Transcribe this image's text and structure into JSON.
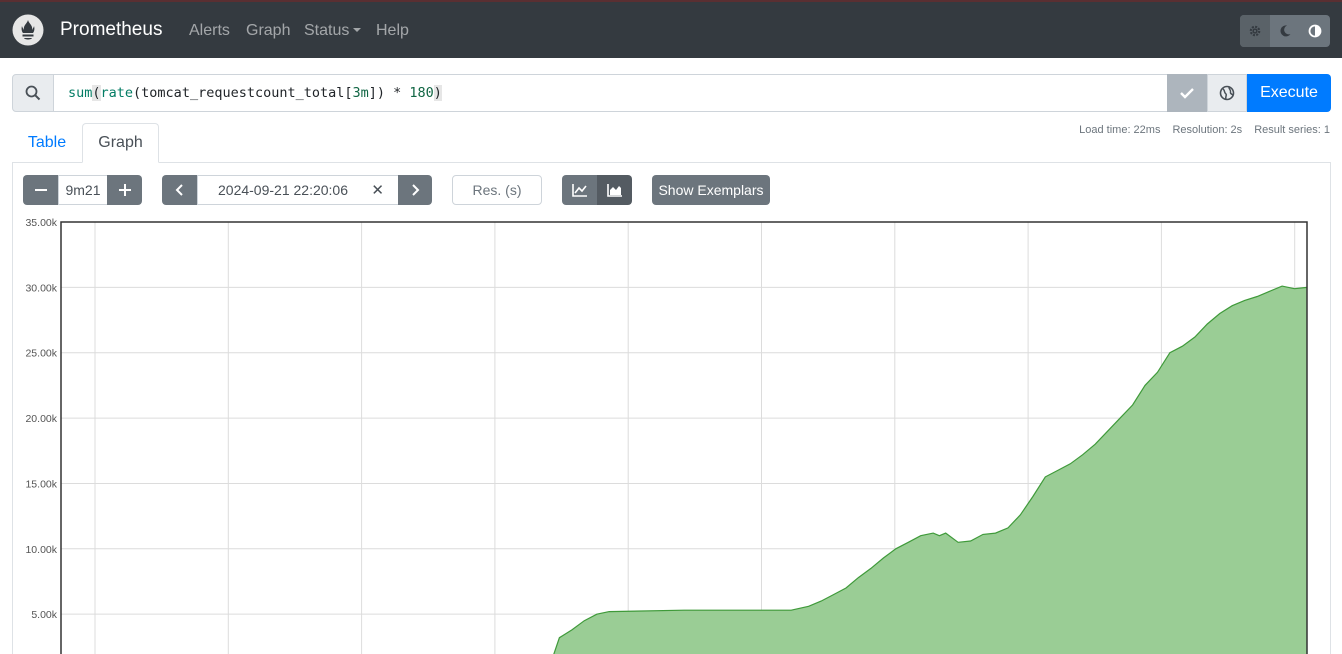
{
  "navbar": {
    "brand": "Prometheus",
    "links": [
      "Alerts",
      "Graph",
      "Status",
      "Help"
    ],
    "theme_buttons": [
      "gear-icon",
      "moon-icon",
      "contrast-icon"
    ]
  },
  "query": {
    "expression": "sum(rate(tomcat_requestcount_total[3m]) * 180)",
    "execute_label": "Execute"
  },
  "tabs": [
    "Table",
    "Graph"
  ],
  "stats": {
    "load_time": "Load time: 22ms",
    "resolution": "Resolution: 2s",
    "result_series": "Result series: 1"
  },
  "graph_controls": {
    "range": "9m21",
    "end_time": "2024-09-21 22:20:06",
    "resolution_placeholder": "Res. (s)",
    "exemplars_label": "Show Exemplars",
    "stacked": true
  },
  "colors": {
    "navbar": "#343a40",
    "primary": "#007bff",
    "series_fill": "#9acd95",
    "series_line": "#3f9a3a"
  },
  "chart_data": {
    "type": "area",
    "y_tick_labels": [
      "35.00k",
      "30.00k",
      "25.00k",
      "20.00k",
      "15.00k",
      "10.00k",
      "5.00k"
    ],
    "ylim": [
      1800,
      35000
    ],
    "xlim": [
      0,
      100
    ],
    "grid": true,
    "series": [
      {
        "points": [
          [
            0,
            0
          ],
          [
            39.5,
            0
          ],
          [
            40,
            3200
          ],
          [
            41,
            3800
          ],
          [
            42,
            4500
          ],
          [
            43,
            5000
          ],
          [
            44,
            5200
          ],
          [
            50,
            5300
          ],
          [
            58,
            5300
          ],
          [
            58.6,
            5300
          ],
          [
            60,
            5600
          ],
          [
            61,
            6000
          ],
          [
            62,
            6500
          ],
          [
            63,
            7000
          ],
          [
            64,
            7800
          ],
          [
            65,
            8500
          ],
          [
            66,
            9300
          ],
          [
            67,
            10000
          ],
          [
            68,
            10500
          ],
          [
            69,
            11000
          ],
          [
            70,
            11200
          ],
          [
            70.5,
            11000
          ],
          [
            71,
            11200
          ],
          [
            72,
            10500
          ],
          [
            73,
            10600
          ],
          [
            74,
            11100
          ],
          [
            75,
            11200
          ],
          [
            76,
            11600
          ],
          [
            77,
            12600
          ],
          [
            78,
            14000
          ],
          [
            79,
            15500
          ],
          [
            80,
            16000
          ],
          [
            81,
            16500
          ],
          [
            82,
            17200
          ],
          [
            83,
            18000
          ],
          [
            84,
            19000
          ],
          [
            85,
            20000
          ],
          [
            86,
            21000
          ],
          [
            87,
            22500
          ],
          [
            88,
            23500
          ],
          [
            89,
            25000
          ],
          [
            90,
            25500
          ],
          [
            91,
            26200
          ],
          [
            92,
            27200
          ],
          [
            93,
            28000
          ],
          [
            94,
            28600
          ],
          [
            95,
            29000
          ],
          [
            96,
            29300
          ],
          [
            97,
            29700
          ],
          [
            98,
            30100
          ],
          [
            99,
            29900
          ],
          [
            100,
            30000
          ]
        ]
      }
    ]
  }
}
